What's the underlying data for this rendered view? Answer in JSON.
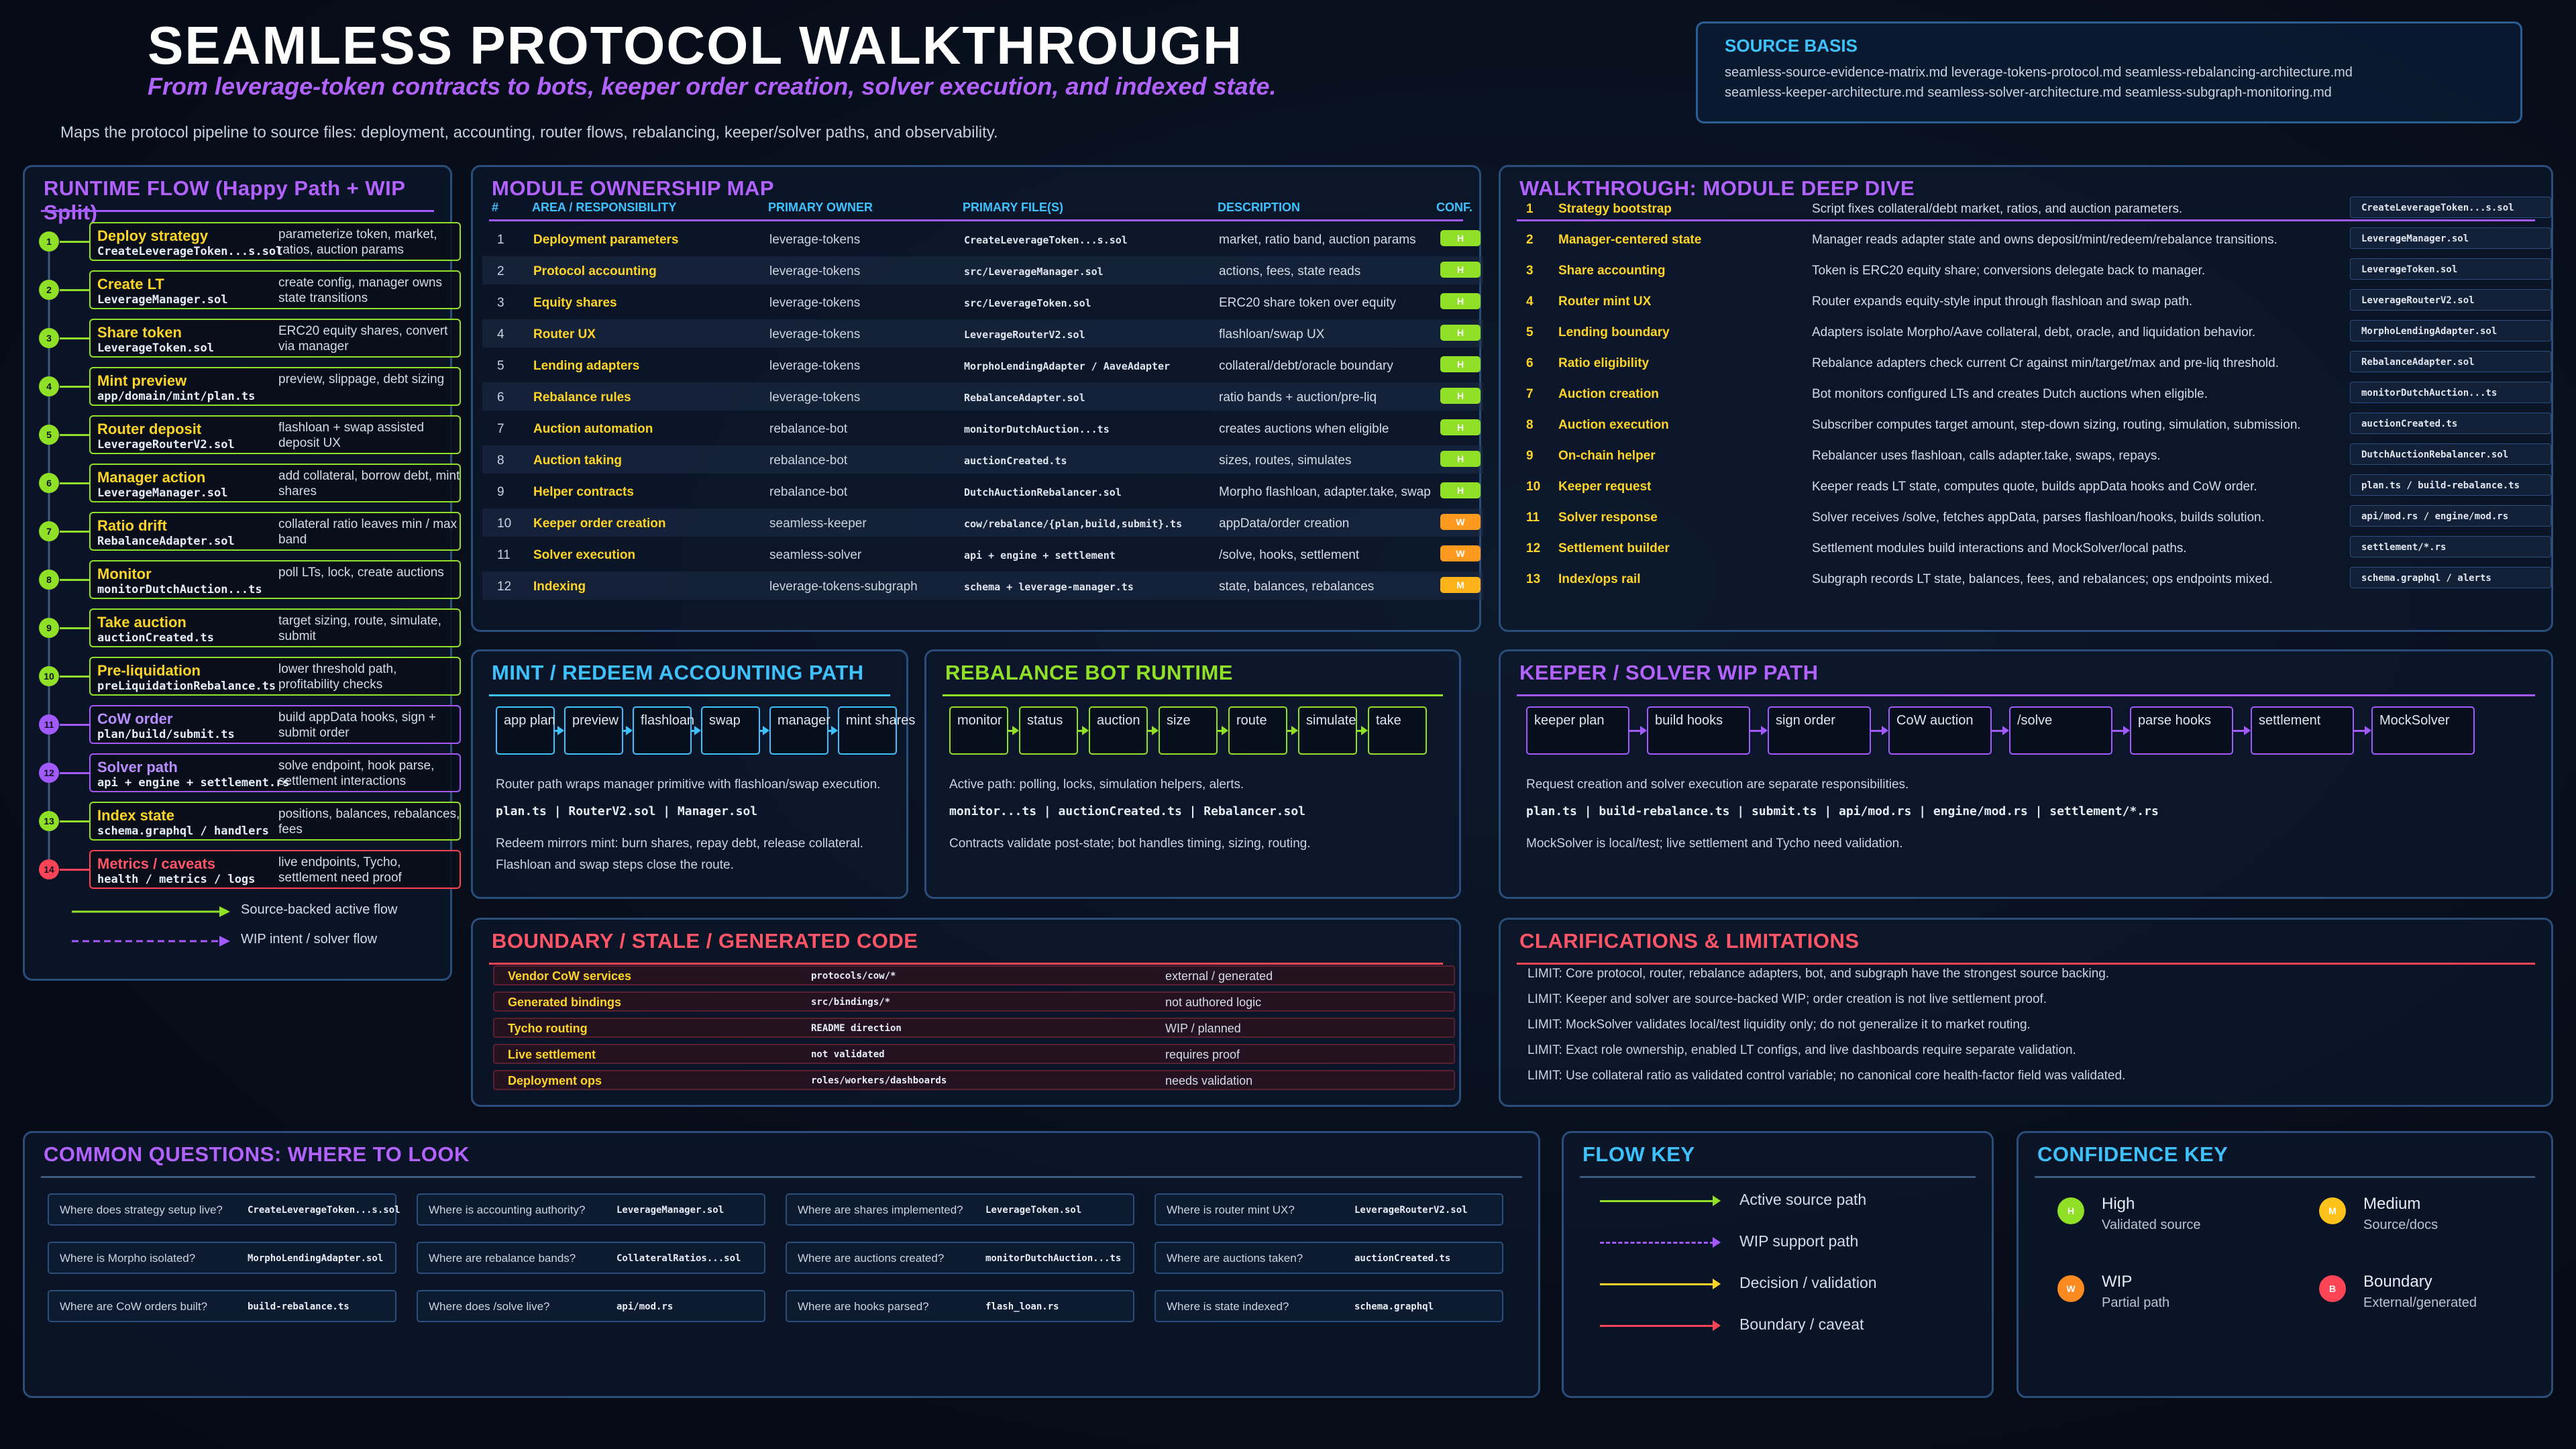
{
  "header": {
    "title": "SEAMLESS PROTOCOL WALKTHROUGH",
    "subtitle": "From leverage-token contracts to bots, keeper order creation, solver execution, and indexed state.",
    "intro": "Maps the protocol pipeline to source files: deployment, accounting, router flows, rebalancing, keeper/solver paths, and observability."
  },
  "source_basis": {
    "title": "SOURCE BASIS",
    "line1": "seamless-source-evidence-matrix.md leverage-tokens-protocol.md seamless-rebalancing-architecture.md",
    "line2": "seamless-keeper-architecture.md seamless-solver-architecture.md seamless-subgraph-monitoring.md"
  },
  "colors": {
    "green": "#8fe026",
    "purple": "#a259ff",
    "yellow": "#ffd429",
    "red": "#ff4455",
    "orange": "#ff9a1f",
    "cyan": "#3ec2ff"
  },
  "runtime_flow": {
    "title": "RUNTIME FLOW (Happy Path + WIP Split)",
    "steps": [
      {
        "num": "1",
        "name": "Deploy strategy",
        "file": "CreateLeverageToken...s.sol",
        "desc": "parameterize token, market, ratios, auction params",
        "kind": "green"
      },
      {
        "num": "2",
        "name": "Create LT",
        "file": "LeverageManager.sol",
        "desc": "create config, manager owns state transitions",
        "kind": "green"
      },
      {
        "num": "3",
        "name": "Share token",
        "file": "LeverageToken.sol",
        "desc": "ERC20 equity shares, convert via manager",
        "kind": "green"
      },
      {
        "num": "4",
        "name": "Mint preview",
        "file": "app/domain/mint/plan.ts",
        "desc": "preview, slippage, debt sizing",
        "kind": "green"
      },
      {
        "num": "5",
        "name": "Router deposit",
        "file": "LeverageRouterV2.sol",
        "desc": "flashloan + swap assisted deposit UX",
        "kind": "green"
      },
      {
        "num": "6",
        "name": "Manager action",
        "file": "LeverageManager.sol",
        "desc": "add collateral, borrow debt, mint shares",
        "kind": "green"
      },
      {
        "num": "7",
        "name": "Ratio drift",
        "file": "RebalanceAdapter.sol",
        "desc": "collateral ratio leaves min / max band",
        "kind": "green"
      },
      {
        "num": "8",
        "name": "Monitor",
        "file": "monitorDutchAuction...ts",
        "desc": "poll LTs, lock, create auctions",
        "kind": "green"
      },
      {
        "num": "9",
        "name": "Take auction",
        "file": "auctionCreated.ts",
        "desc": "target sizing, route, simulate, submit",
        "kind": "green"
      },
      {
        "num": "10",
        "name": "Pre-liquidation",
        "file": "preLiquidationRebalance.ts",
        "desc": "lower threshold path, profitability checks",
        "kind": "green"
      },
      {
        "num": "11",
        "name": "CoW order",
        "file": "plan/build/submit.ts",
        "desc": "build appData hooks, sign + submit order",
        "kind": "purple"
      },
      {
        "num": "12",
        "name": "Solver path",
        "file": "api + engine + settlement.rs",
        "desc": "solve endpoint, hook parse, settlement interactions",
        "kind": "purple"
      },
      {
        "num": "13",
        "name": "Index state",
        "file": "schema.graphql / handlers",
        "desc": "positions, balances, rebalances, fees",
        "kind": "green"
      },
      {
        "num": "14",
        "name": "Metrics / caveats",
        "file": "health / metrics / logs",
        "desc": "live endpoints, Tycho, settlement need proof",
        "kind": "red"
      }
    ],
    "legend_active": "Source-backed active flow",
    "legend_wip": "WIP intent / solver flow"
  },
  "module_map": {
    "title": "MODULE OWNERSHIP MAP",
    "headers": {
      "num": "#",
      "area": "AREA / RESPONSIBILITY",
      "owner": "PRIMARY OWNER",
      "file": "PRIMARY FILE(S)",
      "desc": "DESCRIPTION",
      "conf": "CONF."
    },
    "rows": [
      {
        "num": "1",
        "area": "Deployment parameters",
        "owner": "leverage-tokens",
        "file": "CreateLeverageToken...s.sol",
        "desc": "market, ratio band, auction params",
        "conf": "H"
      },
      {
        "num": "2",
        "area": "Protocol accounting",
        "owner": "leverage-tokens",
        "file": "src/LeverageManager.sol",
        "desc": "actions, fees, state reads",
        "conf": "H"
      },
      {
        "num": "3",
        "area": "Equity shares",
        "owner": "leverage-tokens",
        "file": "src/LeverageToken.sol",
        "desc": "ERC20 share token over equity",
        "conf": "H"
      },
      {
        "num": "4",
        "area": "Router UX",
        "owner": "leverage-tokens",
        "file": "LeverageRouterV2.sol",
        "desc": "flashloan/swap UX",
        "conf": "H"
      },
      {
        "num": "5",
        "area": "Lending adapters",
        "owner": "leverage-tokens",
        "file": "MorphoLendingAdapter / AaveAdapter",
        "desc": "collateral/debt/oracle boundary",
        "conf": "H"
      },
      {
        "num": "6",
        "area": "Rebalance rules",
        "owner": "leverage-tokens",
        "file": "RebalanceAdapter.sol",
        "desc": "ratio bands + auction/pre-liq",
        "conf": "H"
      },
      {
        "num": "7",
        "area": "Auction automation",
        "owner": "rebalance-bot",
        "file": "monitorDutchAuction...ts",
        "desc": "creates auctions when eligible",
        "conf": "H"
      },
      {
        "num": "8",
        "area": "Auction taking",
        "owner": "rebalance-bot",
        "file": "auctionCreated.ts",
        "desc": "sizes, routes, simulates",
        "conf": "H"
      },
      {
        "num": "9",
        "area": "Helper contracts",
        "owner": "rebalance-bot",
        "file": "DutchAuctionRebalancer.sol",
        "desc": "Morpho flashloan, adapter.take, swap",
        "conf": "H"
      },
      {
        "num": "10",
        "area": "Keeper order creation",
        "owner": "seamless-keeper",
        "file": "cow/rebalance/{plan,build,submit}.ts",
        "desc": "appData/order creation",
        "conf": "W"
      },
      {
        "num": "11",
        "area": "Solver execution",
        "owner": "seamless-solver",
        "file": "api + engine + settlement",
        "desc": "/solve, hooks, settlement",
        "conf": "W"
      },
      {
        "num": "12",
        "area": "Indexing",
        "owner": "leverage-tokens-subgraph",
        "file": "schema + leverage-manager.ts",
        "desc": "state, balances, rebalances",
        "conf": "M"
      }
    ]
  },
  "walkthrough": {
    "title": "WALKTHROUGH: MODULE DEEP DIVE",
    "rows": [
      {
        "num": "1",
        "name": "Strategy bootstrap",
        "desc": "Script fixes collateral/debt market, ratios, and auction parameters.",
        "file": "CreateLeverageToken...s.sol"
      },
      {
        "num": "2",
        "name": "Manager-centered state",
        "desc": "Manager reads adapter state and owns deposit/mint/redeem/rebalance transitions.",
        "file": "LeverageManager.sol"
      },
      {
        "num": "3",
        "name": "Share accounting",
        "desc": "Token is ERC20 equity share; conversions delegate back to manager.",
        "file": "LeverageToken.sol"
      },
      {
        "num": "4",
        "name": "Router mint UX",
        "desc": "Router expands equity-style input through flashloan and swap path.",
        "file": "LeverageRouterV2.sol"
      },
      {
        "num": "5",
        "name": "Lending boundary",
        "desc": "Adapters isolate Morpho/Aave collateral, debt, oracle, and liquidation behavior.",
        "file": "MorphoLendingAdapter.sol"
      },
      {
        "num": "6",
        "name": "Ratio eligibility",
        "desc": "Rebalance adapters check current Cr against min/target/max and pre-liq threshold.",
        "file": "RebalanceAdapter.sol"
      },
      {
        "num": "7",
        "name": "Auction creation",
        "desc": "Bot monitors configured LTs and creates Dutch auctions when eligible.",
        "file": "monitorDutchAuction...ts"
      },
      {
        "num": "8",
        "name": "Auction execution",
        "desc": "Subscriber computes target amount, step-down sizing, routing, simulation, submission.",
        "file": "auctionCreated.ts"
      },
      {
        "num": "9",
        "name": "On-chain helper",
        "desc": "Rebalancer uses flashloan, calls adapter.take, swaps, repays.",
        "file": "DutchAuctionRebalancer.sol"
      },
      {
        "num": "10",
        "name": "Keeper request",
        "desc": "Keeper reads LT state, computes quote, builds appData hooks and CoW order.",
        "file": "plan.ts / build-rebalance.ts"
      },
      {
        "num": "11",
        "name": "Solver response",
        "desc": "Solver receives /solve, fetches appData, parses flashloan/hooks, builds solution.",
        "file": "api/mod.rs / engine/mod.rs"
      },
      {
        "num": "12",
        "name": "Settlement builder",
        "desc": "Settlement modules build interactions and MockSolver/local paths.",
        "file": "settlement/*.rs"
      },
      {
        "num": "13",
        "name": "Index/ops rail",
        "desc": "Subgraph records LT state, balances, fees, and rebalances; ops endpoints mixed.",
        "file": "schema.graphql / alerts"
      }
    ]
  },
  "mint_path": {
    "title": "MINT / REDEEM ACCOUNTING PATH",
    "steps": [
      "app plan",
      "preview",
      "flashloan",
      "swap",
      "manager",
      "mint shares"
    ],
    "text1": "Router path wraps manager primitive with flashloan/swap execution.",
    "code": "plan.ts | RouterV2.sol | Manager.sol",
    "text2": "Redeem mirrors mint: burn shares, repay debt, release collateral.",
    "text3": "Flashloan and swap steps close the route."
  },
  "rebalance_bot": {
    "title": "REBALANCE BOT RUNTIME",
    "steps": [
      "monitor",
      "status",
      "auction",
      "size",
      "route",
      "simulate",
      "take"
    ],
    "text1": "Active path: polling, locks, simulation helpers, alerts.",
    "code": "monitor...ts | auctionCreated.ts | Rebalancer.sol",
    "text2": "Contracts validate post-state; bot handles timing, sizing, routing."
  },
  "keeper_solver": {
    "title": "KEEPER / SOLVER WIP PATH",
    "steps": [
      "keeper plan",
      "build hooks",
      "sign order",
      "CoW auction",
      "/solve",
      "parse hooks",
      "settlement",
      "MockSolver"
    ],
    "text1": "Request creation and solver execution are separate responsibilities.",
    "code": "plan.ts | build-rebalance.ts | submit.ts | api/mod.rs | engine/mod.rs | settlement/*.rs",
    "text2": "MockSolver is local/test; live settlement and Tycho need validation."
  },
  "boundary": {
    "title": "BOUNDARY / STALE / GENERATED CODE",
    "rows": [
      {
        "name": "Vendor CoW services",
        "code": "protocols/cow/*",
        "desc": "external / generated"
      },
      {
        "name": "Generated bindings",
        "code": "src/bindings/*",
        "desc": "not authored logic"
      },
      {
        "name": "Tycho routing",
        "code": "README direction",
        "desc": "WIP / planned"
      },
      {
        "name": "Live settlement",
        "code": "not validated",
        "desc": "requires proof"
      },
      {
        "name": "Deployment ops",
        "code": "roles/workers/dashboards",
        "desc": "needs validation"
      }
    ]
  },
  "clarifications": {
    "title": "CLARIFICATIONS & LIMITATIONS",
    "items": [
      "LIMIT: Core protocol, router, rebalance adapters, bot, and subgraph have the strongest source backing.",
      "LIMIT: Keeper and solver are source-backed WIP; order creation is not live settlement proof.",
      "LIMIT: MockSolver validates local/test liquidity only; do not generalize it to market routing.",
      "LIMIT: Exact role ownership, enabled LT configs, and live dashboards require separate validation.",
      "LIMIT: Use collateral ratio as validated control variable; no canonical core health-factor field was validated."
    ]
  },
  "questions": {
    "title": "COMMON QUESTIONS: WHERE TO LOOK",
    "items": [
      {
        "q": "Where does strategy setup live?",
        "file": "CreateLeverageToken...s.sol"
      },
      {
        "q": "Where is accounting authority?",
        "file": "LeverageManager.sol"
      },
      {
        "q": "Where are shares implemented?",
        "file": "LeverageToken.sol"
      },
      {
        "q": "Where is router mint UX?",
        "file": "LeverageRouterV2.sol"
      },
      {
        "q": "Where is Morpho isolated?",
        "file": "MorphoLendingAdapter.sol"
      },
      {
        "q": "Where are rebalance bands?",
        "file": "CollateralRatios...sol"
      },
      {
        "q": "Where are auctions created?",
        "file": "monitorDutchAuction...ts"
      },
      {
        "q": "Where are auctions taken?",
        "file": "auctionCreated.ts"
      },
      {
        "q": "Where are CoW orders built?",
        "file": "build-rebalance.ts"
      },
      {
        "q": "Where does /solve live?",
        "file": "api/mod.rs"
      },
      {
        "q": "Where are hooks parsed?",
        "file": "flash_loan.rs"
      },
      {
        "q": "Where is state indexed?",
        "file": "schema.graphql"
      }
    ]
  },
  "flow_key": {
    "title": "FLOW KEY",
    "items": [
      {
        "label": "Active source path",
        "color": "#8fe026",
        "dashed": false
      },
      {
        "label": "WIP support path",
        "color": "#a259ff",
        "dashed": true
      },
      {
        "label": "Decision / validation",
        "color": "#ffd429",
        "dashed": false
      },
      {
        "label": "Boundary / caveat",
        "color": "#ff4455",
        "dashed": false
      }
    ]
  },
  "confidence_key": {
    "title": "CONFIDENCE KEY",
    "items": [
      {
        "letter": "H",
        "name": "High",
        "sub": "Validated source",
        "color": "#8fe026"
      },
      {
        "letter": "M",
        "name": "Medium",
        "sub": "Source/docs",
        "color": "#ffc21a"
      },
      {
        "letter": "W",
        "name": "WIP",
        "sub": "Partial path",
        "color": "#ff8a1f"
      },
      {
        "letter": "B",
        "name": "Boundary",
        "sub": "External/generated",
        "color": "#ff4455"
      }
    ]
  }
}
